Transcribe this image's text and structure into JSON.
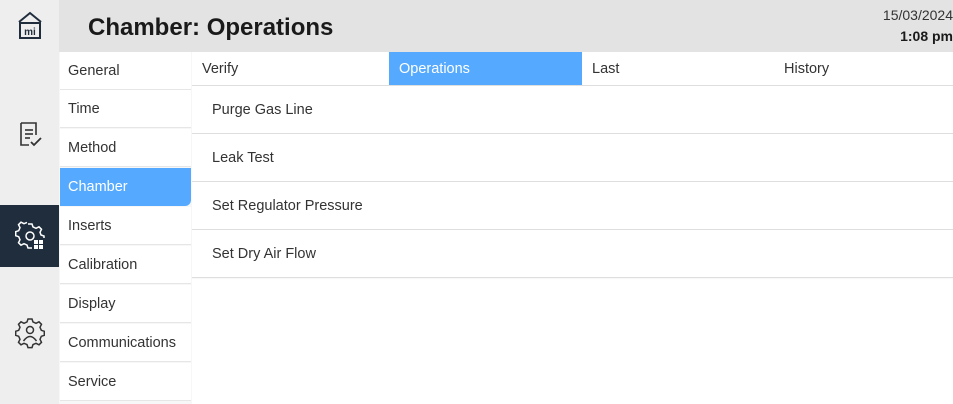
{
  "header": {
    "title": "Chamber: Operations",
    "date": "15/03/2024",
    "time": "1:08 pm"
  },
  "rail": {
    "icons": [
      "home-icon",
      "checklist-icon",
      "settings-grid-icon",
      "user-settings-icon"
    ],
    "home_logo_text": "mi"
  },
  "menu": {
    "items": [
      {
        "label": "General"
      },
      {
        "label": "Time"
      },
      {
        "label": "Method"
      },
      {
        "label": "Chamber"
      },
      {
        "label": "Inserts"
      },
      {
        "label": "Calibration"
      },
      {
        "label": "Display"
      },
      {
        "label": "Communications"
      },
      {
        "label": "Service"
      }
    ],
    "selected": "Chamber"
  },
  "tabs": {
    "items": [
      {
        "label": "Verify"
      },
      {
        "label": "Operations"
      },
      {
        "label": "Last"
      },
      {
        "label": "History"
      }
    ],
    "selected": "Operations"
  },
  "operations": {
    "items": [
      {
        "label": "Purge Gas Line"
      },
      {
        "label": "Leak Test"
      },
      {
        "label": "Set Regulator Pressure"
      },
      {
        "label": "Set Dry Air Flow"
      }
    ]
  },
  "colors": {
    "accent": "#55aaff",
    "rail_active": "#1f2d3d",
    "header_bg": "#e3e3e3"
  }
}
